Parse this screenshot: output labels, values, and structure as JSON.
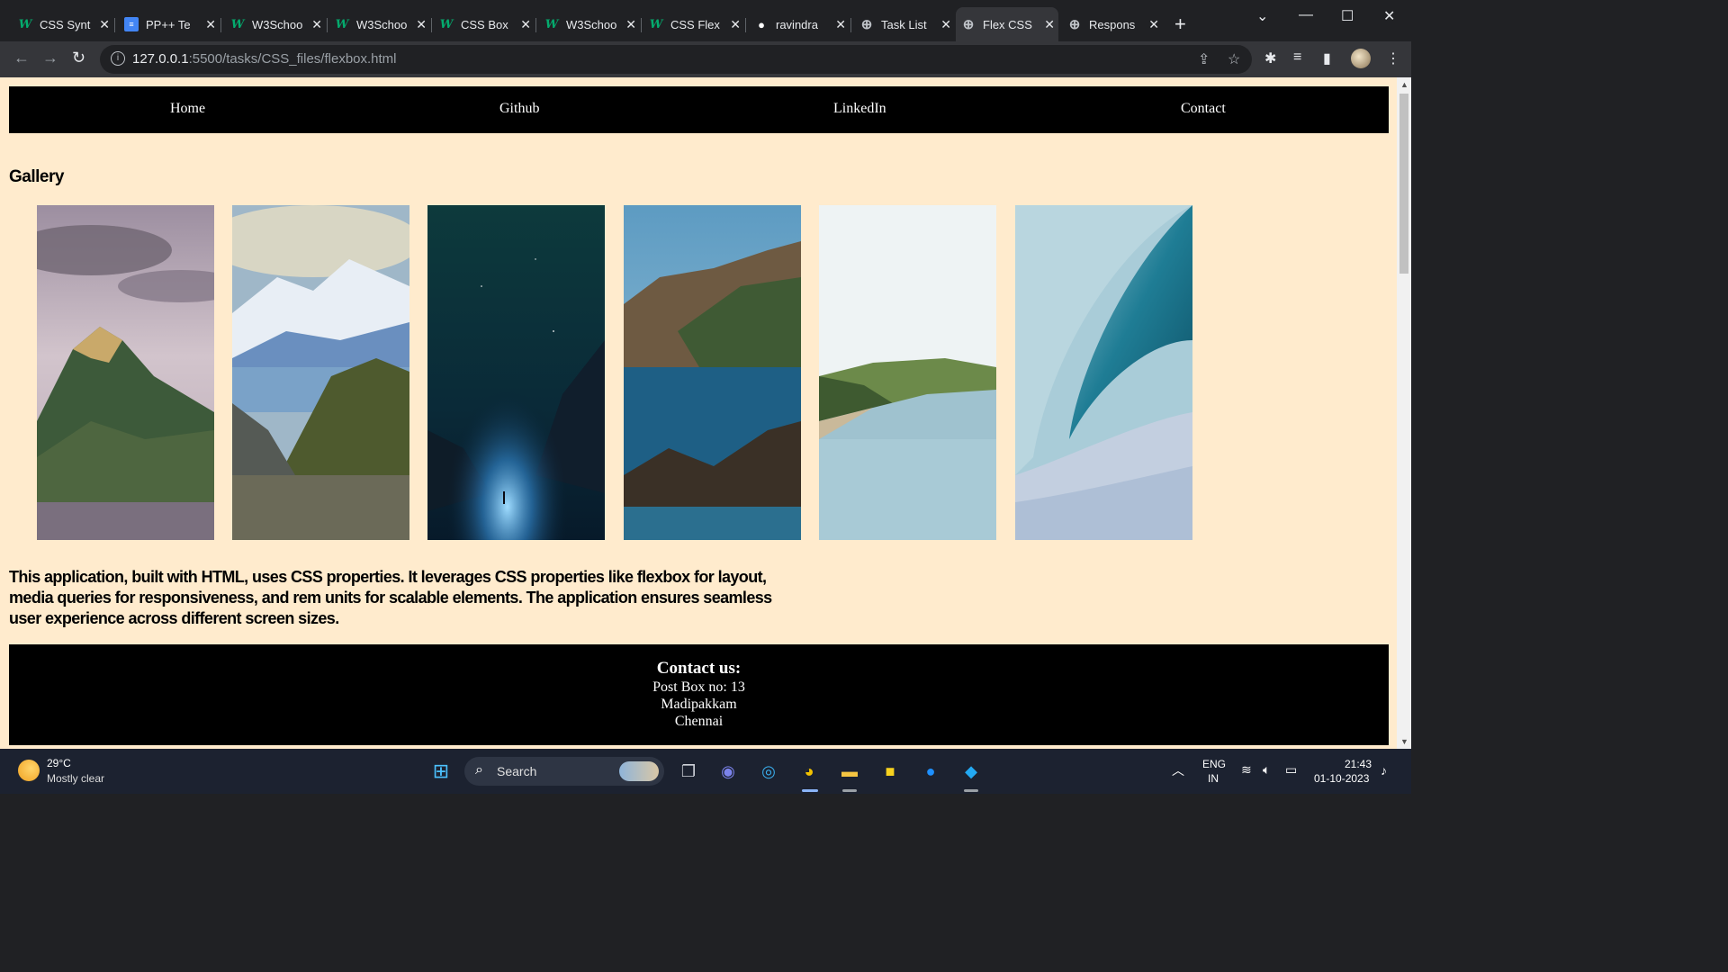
{
  "browser": {
    "tabs": [
      {
        "title": "CSS Synt",
        "icon": "w3schools-icon"
      },
      {
        "title": "PP++ Te",
        "icon": "docs-icon"
      },
      {
        "title": "W3Schoo",
        "icon": "w3schools-icon"
      },
      {
        "title": "W3Schoo",
        "icon": "w3schools-icon"
      },
      {
        "title": "CSS Box",
        "icon": "w3schools-icon"
      },
      {
        "title": "W3Schoo",
        "icon": "w3schools-icon"
      },
      {
        "title": "CSS Flex",
        "icon": "w3schools-icon"
      },
      {
        "title": "ravindra",
        "icon": "github-icon"
      },
      {
        "title": "Task List",
        "icon": "globe-icon"
      },
      {
        "title": "Flex CSS",
        "icon": "globe-icon",
        "active": true
      },
      {
        "title": "Respons",
        "icon": "globe-icon"
      }
    ],
    "url_host": "127.0.0.1",
    "url_path": ":5500/tasks/CSS_files/flexbox.html"
  },
  "page": {
    "nav": {
      "home": "Home",
      "github": "Github",
      "linkedin": "LinkedIn",
      "contact": "Contact"
    },
    "gallery_title": "Gallery",
    "gallery": [
      {
        "alt": "mountain-peak-clouds"
      },
      {
        "alt": "snowy-mountains-glacier"
      },
      {
        "alt": "aurora-night-valley"
      },
      {
        "alt": "coastal-cliffs-bridge"
      },
      {
        "alt": "beach-cliffs-shore"
      },
      {
        "alt": "ocean-wave"
      }
    ],
    "description": "This application, built with HTML, uses CSS properties. It leverages CSS properties like flexbox for layout, media queries for responsiveness, and rem units for scalable elements. The application ensures seamless user experience across different screen sizes.",
    "footer": {
      "title": "Contact us:",
      "line1": "Post Box no: 13",
      "line2": "Madipakkam",
      "line3": "Chennai"
    },
    "colors": {
      "background": "#ffebcd",
      "nav": "#000000",
      "footer": "#000000"
    }
  },
  "taskbar": {
    "weather_temp": "29°C",
    "weather_desc": "Mostly clear",
    "search_placeholder": "Search",
    "lang": "ENG",
    "region": "IN",
    "time": "21:43",
    "date": "01-10-2023"
  }
}
